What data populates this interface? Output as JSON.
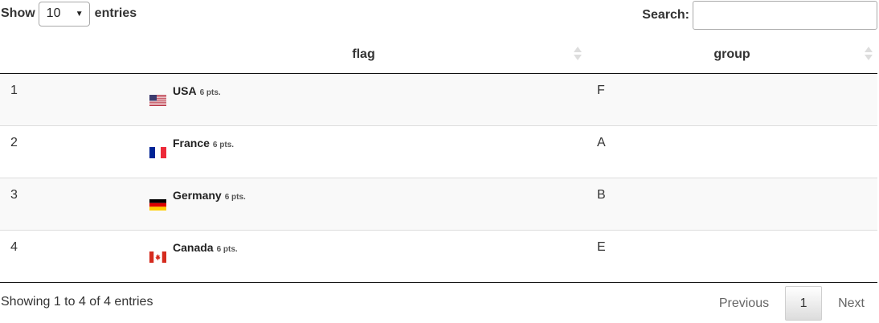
{
  "length_control": {
    "show_label": "Show",
    "selected": "10",
    "entries_label": "entries"
  },
  "search": {
    "label": "Search:",
    "value": "",
    "placeholder": ""
  },
  "table": {
    "columns": [
      "",
      "flag",
      "group"
    ],
    "rows": [
      {
        "index": "1",
        "country": "USA",
        "points": "6 pts.",
        "flag_icon": "us-flag-icon",
        "group": "F"
      },
      {
        "index": "2",
        "country": "France",
        "points": "6 pts.",
        "flag_icon": "fr-flag-icon",
        "group": "A"
      },
      {
        "index": "3",
        "country": "Germany",
        "points": "6 pts.",
        "flag_icon": "de-flag-icon",
        "group": "B"
      },
      {
        "index": "4",
        "country": "Canada",
        "points": "6 pts.",
        "flag_icon": "ca-flag-icon",
        "group": "E"
      }
    ]
  },
  "footer": {
    "info": "Showing 1 to 4 of 4 entries",
    "previous": "Previous",
    "current_page": "1",
    "next": "Next"
  }
}
